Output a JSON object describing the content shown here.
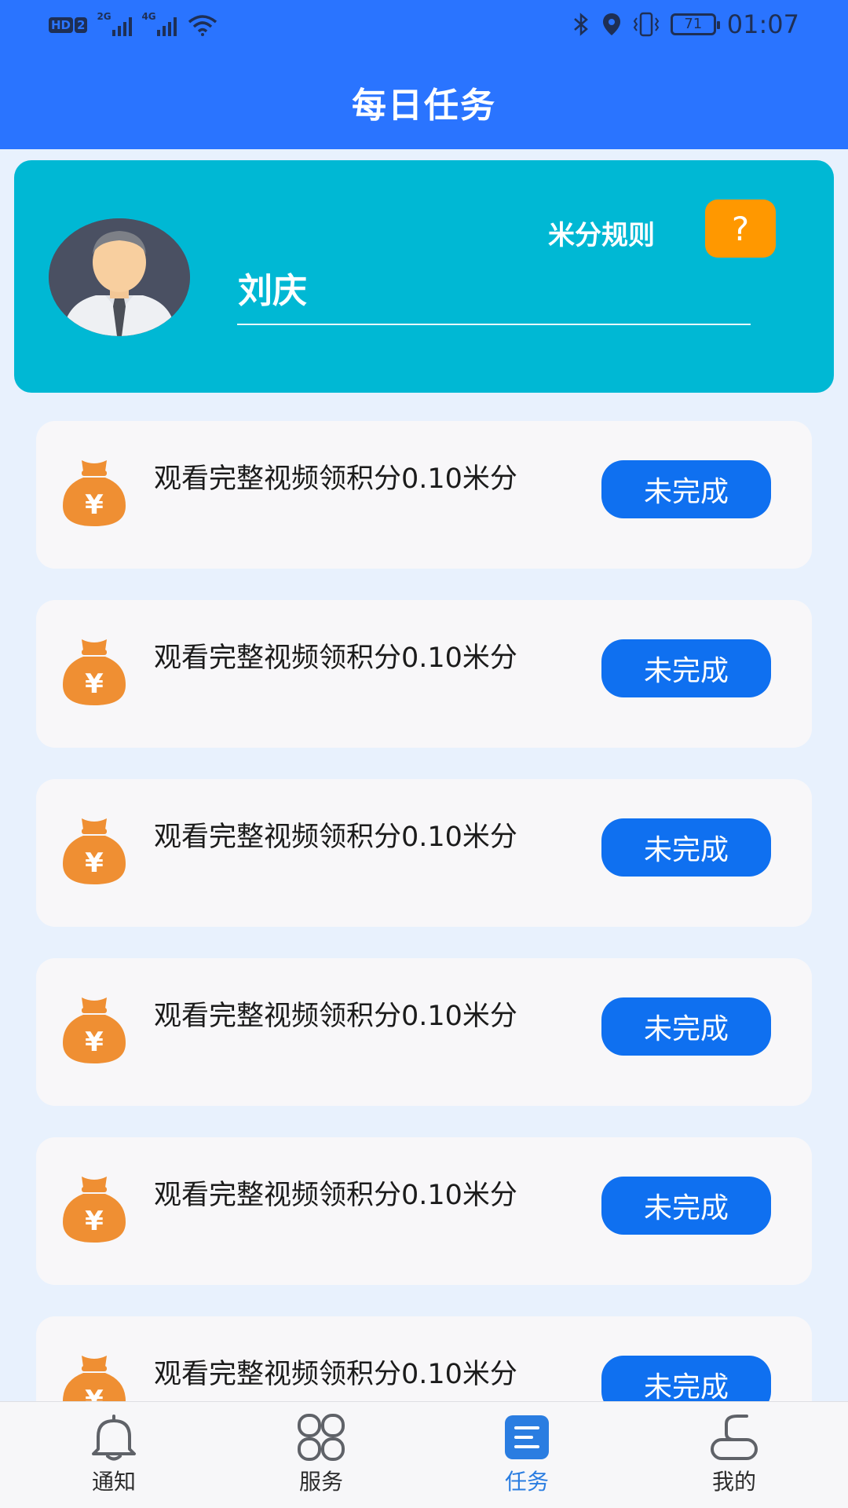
{
  "status_bar": {
    "hd_badges": [
      "HD",
      "2"
    ],
    "signal_labels": [
      "2G",
      "4G"
    ],
    "battery": "71",
    "time": "01:07"
  },
  "header": {
    "title": "每日任务"
  },
  "profile": {
    "username": "刘庆",
    "rules_label": "米分规则",
    "help_symbol": "?"
  },
  "tasks": [
    {
      "text": "观看完整视频领积分0.10米分",
      "status": "未完成"
    },
    {
      "text": "观看完整视频领积分0.10米分",
      "status": "未完成"
    },
    {
      "text": "观看完整视频领积分0.10米分",
      "status": "未完成"
    },
    {
      "text": "观看完整视频领积分0.10米分",
      "status": "未完成"
    },
    {
      "text": "观看完整视频领积分0.10米分",
      "status": "未完成"
    },
    {
      "text": "观看完整视频领积分0.10米分",
      "status": "未完成"
    }
  ],
  "bottom_nav": {
    "items": [
      {
        "label": "通知",
        "icon": "bell-icon",
        "active": false
      },
      {
        "label": "服务",
        "icon": "grid-icon",
        "active": false
      },
      {
        "label": "任务",
        "icon": "task-list-icon",
        "active": true
      },
      {
        "label": "我的",
        "icon": "user-icon",
        "active": false
      }
    ]
  },
  "colors": {
    "header": "#2a74ff",
    "profile_card": "#00b8d4",
    "help_button": "#ff9800",
    "status_button": "#0f70f0",
    "money_bag": "#ef8f33",
    "nav_active": "#2a7de1"
  }
}
